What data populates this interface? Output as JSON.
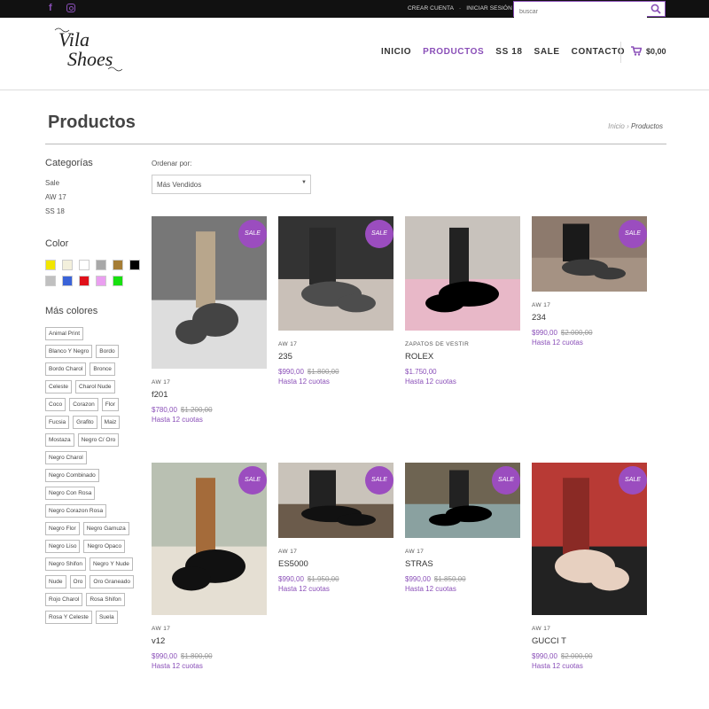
{
  "topbar": {
    "create_account": "CREAR CUENTA",
    "separator": "-",
    "login": "INICIAR SESIÓN",
    "search_placeholder": "buscar",
    "social": [
      "facebook-icon",
      "instagram-icon"
    ]
  },
  "header": {
    "logo_line1": "Vila",
    "logo_line2": "Shoes",
    "nav": [
      "INICIO",
      "PRODUCTOS",
      "SS 18",
      "SALE",
      "CONTACTO"
    ],
    "cart_total": "$0,00"
  },
  "page": {
    "title": "Productos",
    "breadcrumb_home": "Inicio",
    "breadcrumb_sep": "›",
    "breadcrumb_current": "Productos"
  },
  "sidebar": {
    "categories_title": "Categorías",
    "categories": [
      "Sale",
      "AW 17",
      "SS 18"
    ],
    "color_title": "Color",
    "colors": [
      "#f2e600",
      "#f3f0dc",
      "#ffffff",
      "#a8a8a8",
      "#a57d35",
      "#000000",
      "#c0c0c0",
      "#3a63d8",
      "#e0101a",
      "#ea9ff0",
      "#18e010"
    ],
    "more_colors_title": "Más colores",
    "tags": [
      "Animal Print",
      "Blanco Y Negro",
      "Bordo",
      "Bordo Charol",
      "Bronce",
      "Celeste",
      "Charol Nude",
      "Coco",
      "Corazon",
      "Flor",
      "Fucsia",
      "Grafito",
      "Maiz",
      "Mostaza",
      "Negro C/ Oro",
      "Negro Charol",
      "Negro Combinado",
      "Negro Con Rosa",
      "Negro Corazon Rosa",
      "Negro Flor",
      "Negro Gamuza",
      "Negro Liso",
      "Negro Opaco",
      "Negro Shifon",
      "Negro Y Nude",
      "Nude",
      "Oro",
      "Oro Graneado",
      "Rojo Charol",
      "Rosa Shifon",
      "Rosa Y Celeste",
      "Suela"
    ]
  },
  "sort": {
    "label": "Ordenar por:",
    "selected": "Más Vendidos"
  },
  "badge": "SALE",
  "products": [
    {
      "category": "AW 17",
      "name": "f201",
      "price": "$780,00",
      "old_price": "$1.200,00",
      "cuotas": "Hasta 12 cuotas",
      "sale": true
    },
    {
      "category": "AW 17",
      "name": "235",
      "price": "$990,00",
      "old_price": "$1.800,00",
      "cuotas": "Hasta 12 cuotas",
      "sale": true
    },
    {
      "category": "ZAPATOS DE VESTIR",
      "name": "ROLEX",
      "price": "$1.750,00",
      "old_price": "",
      "cuotas": "Hasta 12 cuotas",
      "sale": false
    },
    {
      "category": "AW 17",
      "name": "234",
      "price": "$990,00",
      "old_price": "$2.000,00",
      "cuotas": "Hasta 12 cuotas",
      "sale": true
    },
    {
      "category": "AW 17",
      "name": "v12",
      "price": "$990,00",
      "old_price": "$1.800,00",
      "cuotas": "Hasta 12 cuotas",
      "sale": true
    },
    {
      "category": "AW 17",
      "name": "ES5000",
      "price": "$990,00",
      "old_price": "$1.950,00",
      "cuotas": "Hasta 12 cuotas",
      "sale": true
    },
    {
      "category": "AW 17",
      "name": "STRAS",
      "price": "$990,00",
      "old_price": "$1.850,00",
      "cuotas": "Hasta 12 cuotas",
      "sale": true
    },
    {
      "category": "AW 17",
      "name": "GUCCI T",
      "price": "$990,00",
      "old_price": "$2.000,00",
      "cuotas": "Hasta 12 cuotas",
      "sale": true
    }
  ]
}
